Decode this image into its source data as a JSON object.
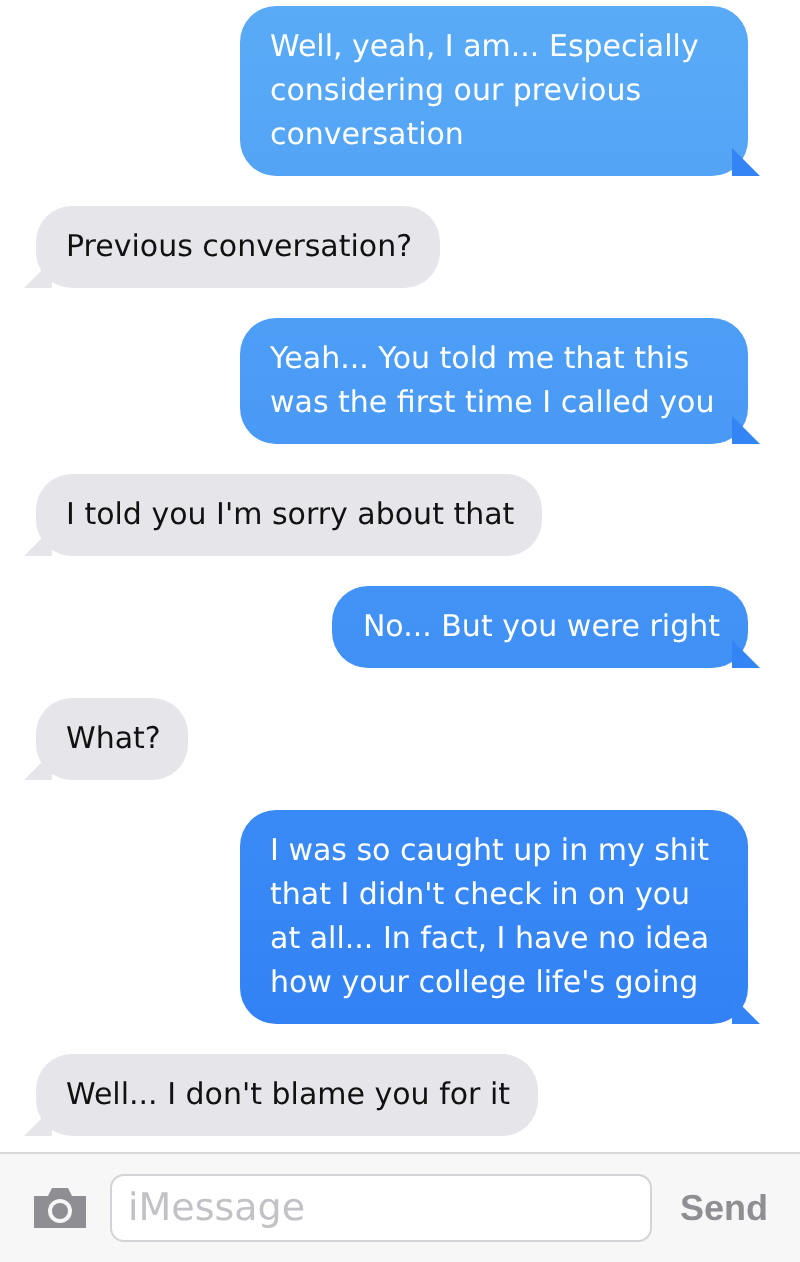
{
  "messages": [
    {
      "kind": "sent",
      "text": "Well, yeah, I am... Especially considering our previous conversation"
    },
    {
      "kind": "received",
      "text": "Previous conversation?"
    },
    {
      "kind": "sent",
      "text": "Yeah... You told me that this was the first time I called you"
    },
    {
      "kind": "received",
      "text": "I told you I'm sorry about that"
    },
    {
      "kind": "sent",
      "text": "No... But you were right"
    },
    {
      "kind": "received",
      "text": "What?"
    },
    {
      "kind": "sent",
      "text": "I was so caught up in my shit that I didn't check in on you at all... In fact, I have no idea how your college life's going"
    },
    {
      "kind": "received",
      "text": "Well... I don't blame you for it"
    }
  ],
  "composer": {
    "placeholder": "iMessage",
    "send_label": "Send"
  }
}
